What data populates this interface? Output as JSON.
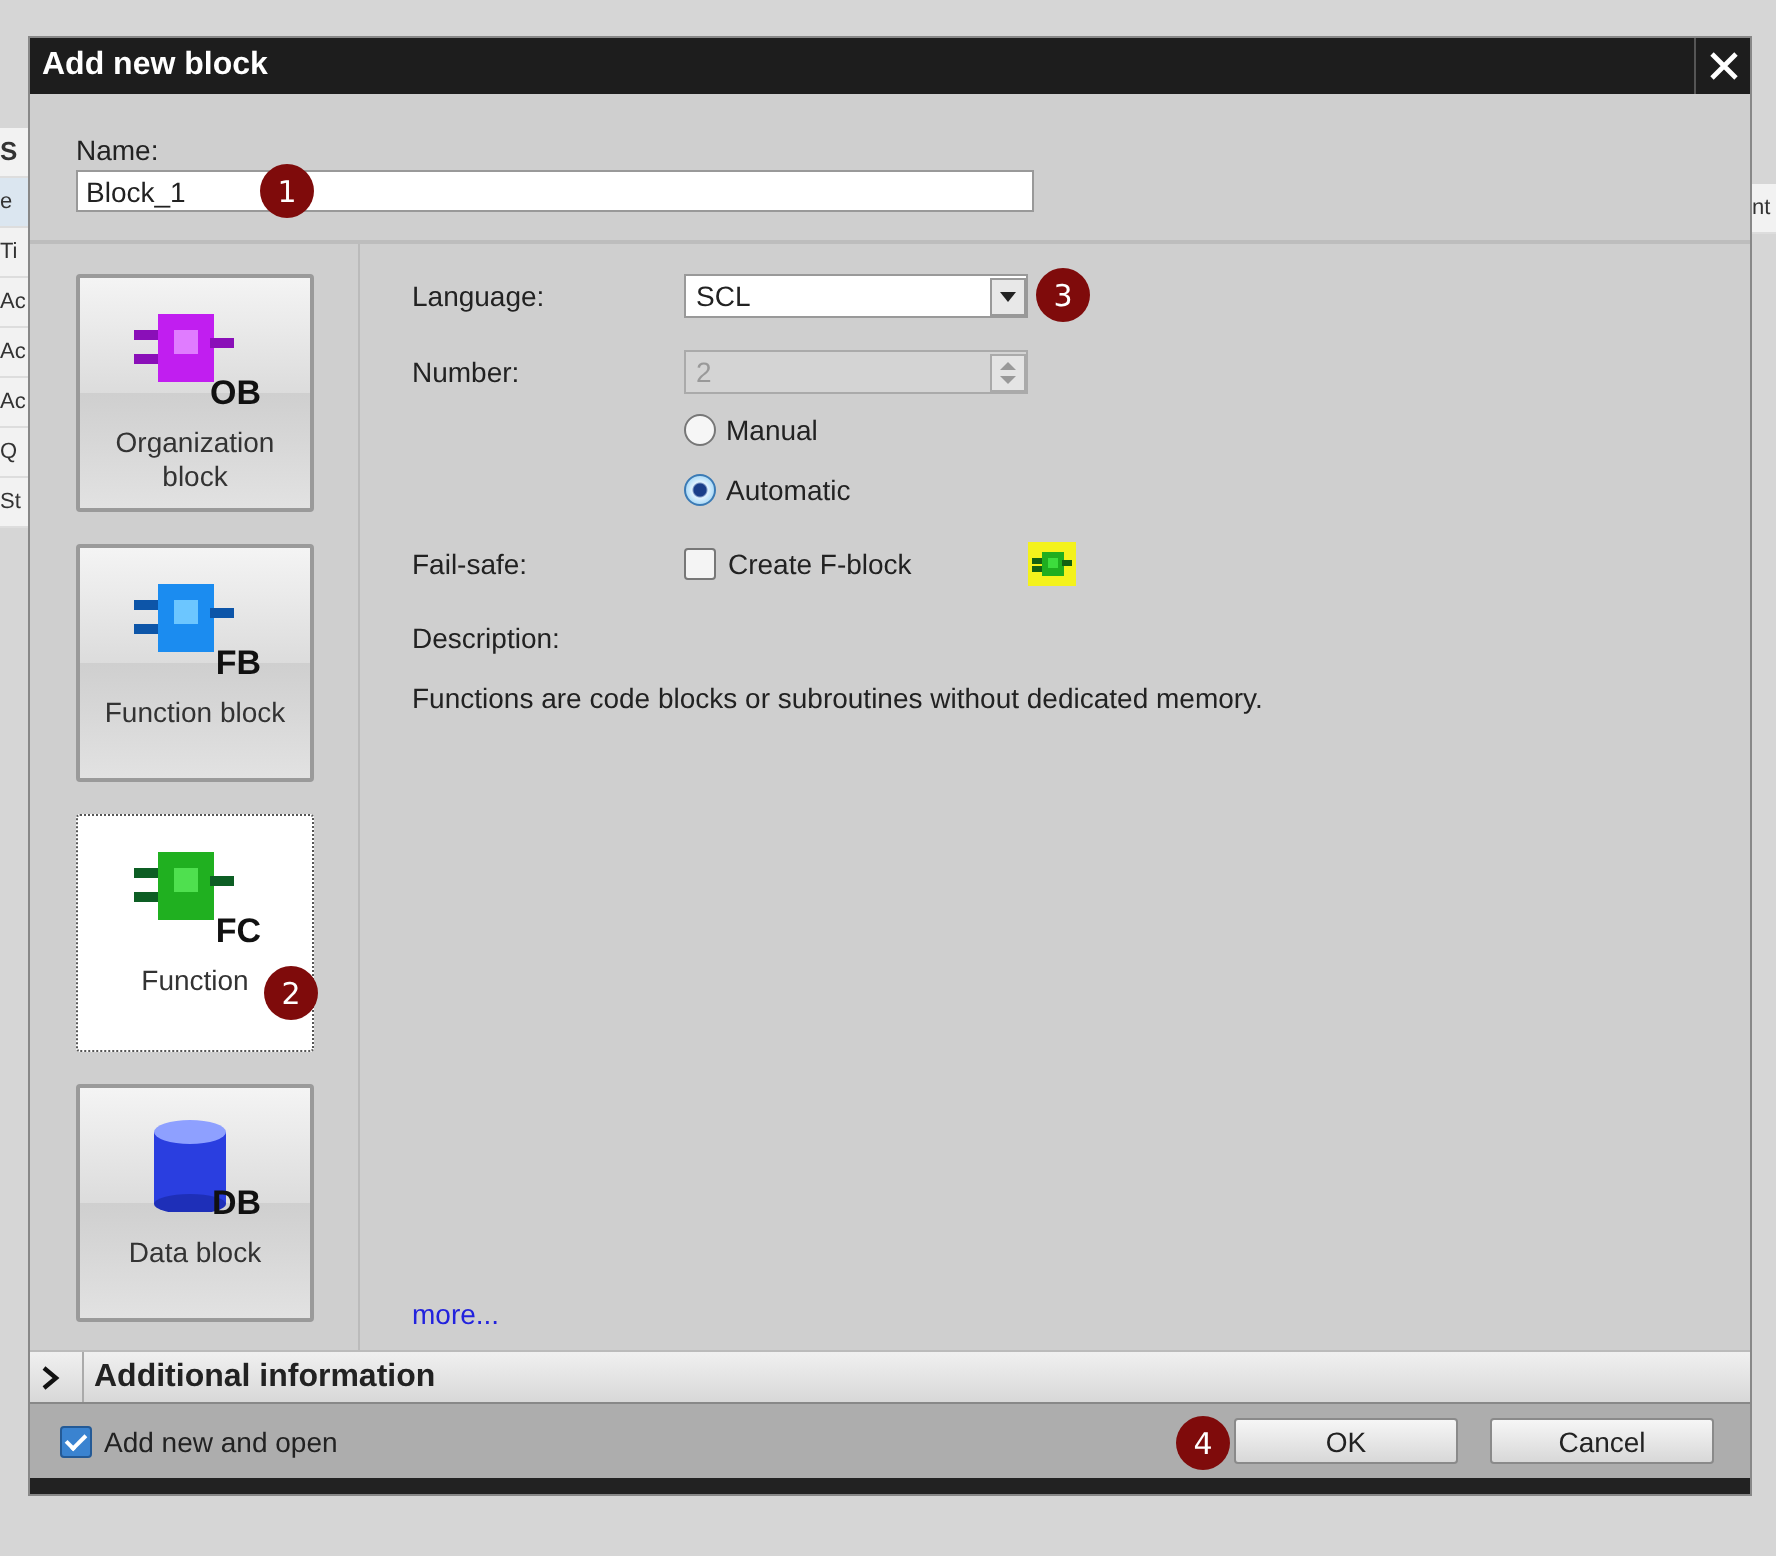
{
  "background": {
    "left_fragments": [
      "S",
      "e",
      "Ti",
      "Ac",
      "Ac",
      "Ac",
      "Q",
      "St"
    ],
    "right_fragments": [
      "nt"
    ]
  },
  "window": {
    "title": "Add new block"
  },
  "name_field": {
    "label": "Name:",
    "value": "Block_1",
    "badge": "1"
  },
  "blocks": [
    {
      "kind": "ob",
      "tag": "OB",
      "label": "Organization block",
      "selected": false
    },
    {
      "kind": "fb",
      "tag": "FB",
      "label": "Function block",
      "selected": false
    },
    {
      "kind": "fc",
      "tag": "FC",
      "label": "Function",
      "selected": true,
      "badge": "2"
    },
    {
      "kind": "db",
      "tag": "DB",
      "label": "Data block",
      "selected": false
    }
  ],
  "language": {
    "label": "Language:",
    "value": "SCL",
    "badge": "3"
  },
  "number": {
    "label": "Number:",
    "value": "2",
    "disabled": true
  },
  "number_mode": [
    {
      "label": "Manual",
      "selected": false
    },
    {
      "label": "Automatic",
      "selected": true
    }
  ],
  "fail_safe": {
    "label": "Fail-safe:",
    "option": "Create F-block",
    "checked": false
  },
  "description": {
    "label": "Description:",
    "text": "Functions are code blocks or subroutines without dedicated memory."
  },
  "more_link": "more...",
  "additional_information": {
    "label": "Additional information",
    "expanded": false
  },
  "add_new_and_open": {
    "label": "Add new and open",
    "checked": true
  },
  "buttons": [
    {
      "label": "OK",
      "badge": "4"
    },
    {
      "label": "Cancel"
    }
  ]
}
